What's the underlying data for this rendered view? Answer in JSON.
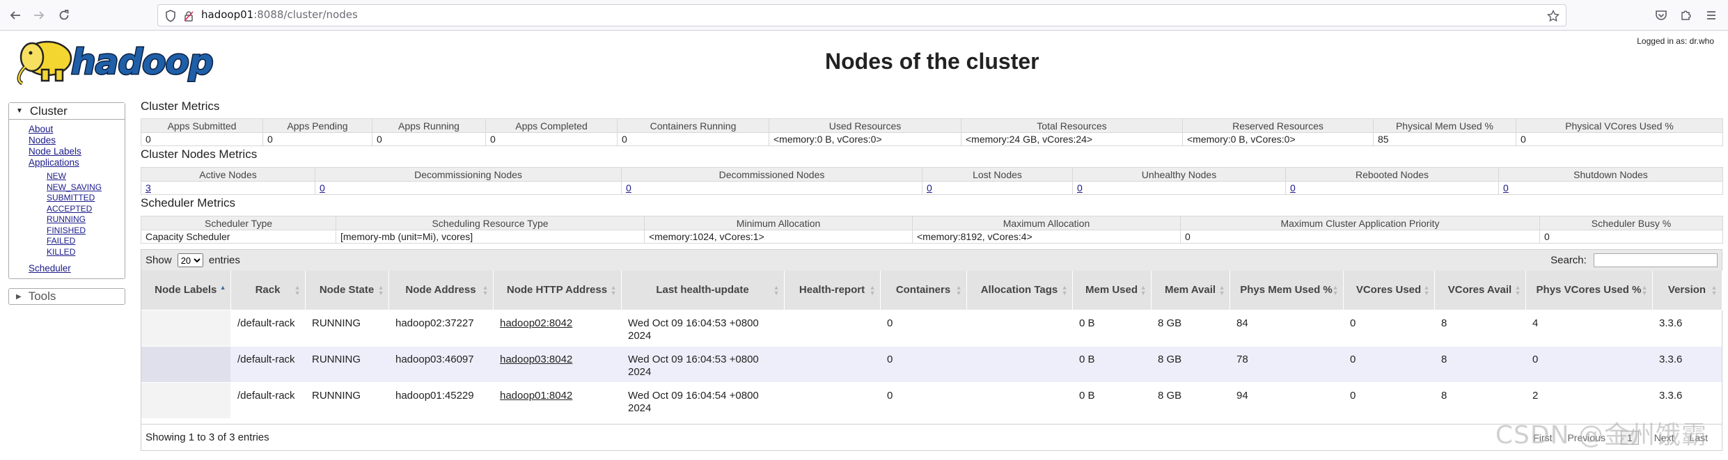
{
  "browser": {
    "url_host": "hadoop01",
    "url_rest": ":8088/cluster/nodes"
  },
  "page": {
    "title": "Nodes of the cluster",
    "logged_in": "Logged in as: dr.who",
    "logo_text": "hadoop"
  },
  "nav": {
    "cluster_label": "Cluster",
    "links": [
      "About",
      "Nodes",
      "Node Labels",
      "Applications"
    ],
    "app_states": [
      "NEW",
      "NEW_SAVING",
      "SUBMITTED",
      "ACCEPTED",
      "RUNNING",
      "FINISHED",
      "FAILED",
      "KILLED"
    ],
    "scheduler": "Scheduler",
    "tools_label": "Tools"
  },
  "cluster_metrics": {
    "title": "Cluster Metrics",
    "headers": [
      "Apps Submitted",
      "Apps Pending",
      "Apps Running",
      "Apps Completed",
      "Containers Running",
      "Used Resources",
      "Total Resources",
      "Reserved Resources",
      "Physical Mem Used %",
      "Physical VCores Used %"
    ],
    "values": [
      "0",
      "0",
      "0",
      "0",
      "0",
      "<memory:0 B, vCores:0>",
      "<memory:24 GB, vCores:24>",
      "<memory:0 B, vCores:0>",
      "85",
      "0"
    ]
  },
  "node_metrics": {
    "title": "Cluster Nodes Metrics",
    "headers": [
      "Active Nodes",
      "Decommissioning Nodes",
      "Decommissioned Nodes",
      "Lost Nodes",
      "Unhealthy Nodes",
      "Rebooted Nodes",
      "Shutdown Nodes"
    ],
    "values": [
      "3",
      "0",
      "0",
      "0",
      "0",
      "0",
      "0"
    ]
  },
  "scheduler_metrics": {
    "title": "Scheduler Metrics",
    "headers": [
      "Scheduler Type",
      "Scheduling Resource Type",
      "Minimum Allocation",
      "Maximum Allocation",
      "Maximum Cluster Application Priority",
      "Scheduler Busy %"
    ],
    "values": [
      "Capacity Scheduler",
      "[memory-mb (unit=Mi), vcores]",
      "<memory:1024, vCores:1>",
      "<memory:8192, vCores:4>",
      "0",
      "0"
    ]
  },
  "datatable": {
    "show_label": "Show",
    "entries_label": "entries",
    "page_size": "20",
    "search_label": "Search:",
    "headers": [
      "Node Labels",
      "Rack",
      "Node State",
      "Node Address",
      "Node HTTP Address",
      "Last health-update",
      "Health-report",
      "Containers",
      "Allocation Tags",
      "Mem Used",
      "Mem Avail",
      "Phys Mem Used %",
      "VCores Used",
      "VCores Avail",
      "Phys VCores Used %",
      "Version"
    ],
    "rows": [
      {
        "labels": "",
        "rack": "/default-rack",
        "state": "RUNNING",
        "address": "hadoop02:37227",
        "http": "hadoop02:8042",
        "health_update": "Wed Oct 09 16:04:53 +0800 2024",
        "report": "",
        "containers": "0",
        "tags": "",
        "mem_used": "0 B",
        "mem_avail": "8 GB",
        "phys_mem": "84",
        "vc_used": "0",
        "vc_avail": "8",
        "phys_vc": "4",
        "version": "3.3.6"
      },
      {
        "labels": "",
        "rack": "/default-rack",
        "state": "RUNNING",
        "address": "hadoop03:46097",
        "http": "hadoop03:8042",
        "health_update": "Wed Oct 09 16:04:53 +0800 2024",
        "report": "",
        "containers": "0",
        "tags": "",
        "mem_used": "0 B",
        "mem_avail": "8 GB",
        "phys_mem": "78",
        "vc_used": "0",
        "vc_avail": "8",
        "phys_vc": "0",
        "version": "3.3.6"
      },
      {
        "labels": "",
        "rack": "/default-rack",
        "state": "RUNNING",
        "address": "hadoop01:45229",
        "http": "hadoop01:8042",
        "health_update": "Wed Oct 09 16:04:54 +0800 2024",
        "report": "",
        "containers": "0",
        "tags": "",
        "mem_used": "0 B",
        "mem_avail": "8 GB",
        "phys_mem": "94",
        "vc_used": "0",
        "vc_avail": "8",
        "phys_vc": "2",
        "version": "3.3.6"
      }
    ],
    "info": "Showing 1 to 3 of 3 entries",
    "pager": {
      "first": "First",
      "previous": "Previous",
      "current": "1",
      "next": "Next",
      "last": "Last"
    }
  },
  "watermark": "CSDN @金州饿霸",
  "icons": {
    "back": "arrow-left-icon",
    "forward": "arrow-right-icon",
    "reload": "reload-icon",
    "shield": "shield-icon",
    "bookmark": "star-icon",
    "pocket": "pocket-icon",
    "extensions": "puzzle-icon",
    "menu": "hamburger-icon"
  }
}
